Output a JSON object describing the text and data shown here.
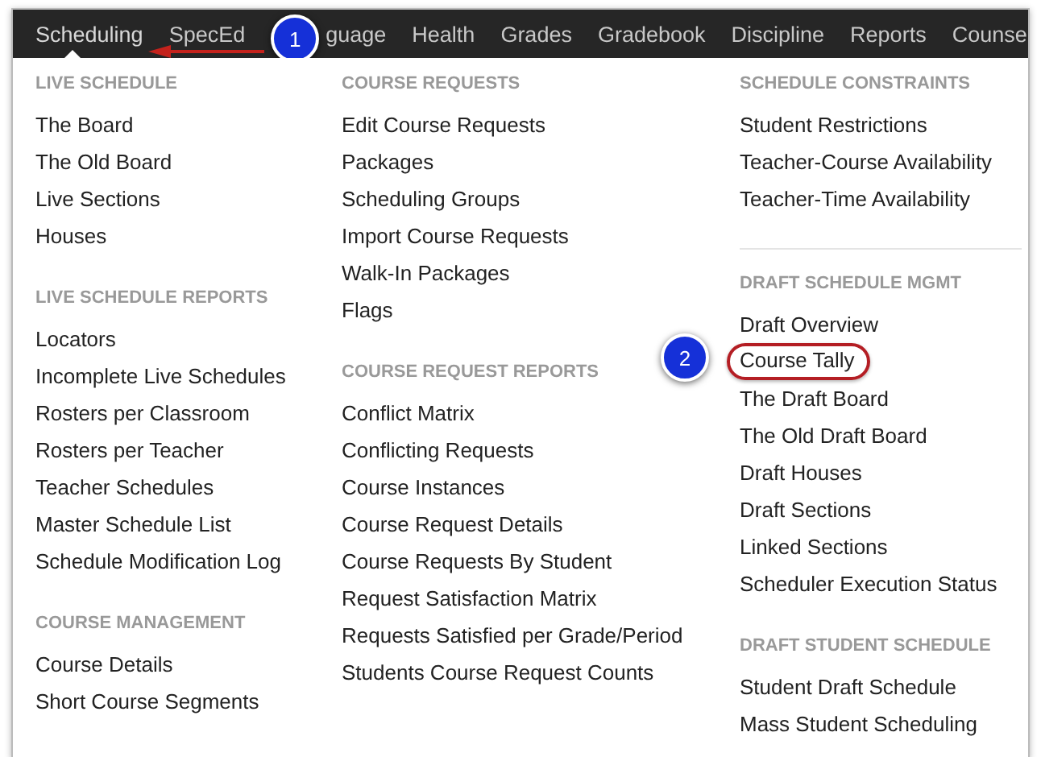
{
  "nav": [
    {
      "label": "Scheduling",
      "selected": true
    },
    {
      "label": "SpecEd",
      "selected": false
    },
    {
      "label": "guage",
      "selected": false
    },
    {
      "label": "Health",
      "selected": false
    },
    {
      "label": "Grades",
      "selected": false
    },
    {
      "label": "Gradebook",
      "selected": false
    },
    {
      "label": "Discipline",
      "selected": false
    },
    {
      "label": "Reports",
      "selected": false
    },
    {
      "label": "Counse",
      "selected": false
    }
  ],
  "columns": [
    [
      {
        "heading": "LIVE SCHEDULE",
        "items": [
          {
            "label": "The Board",
            "circled": false
          },
          {
            "label": "The Old Board",
            "circled": false
          },
          {
            "label": "Live Sections",
            "circled": false
          },
          {
            "label": "Houses",
            "circled": false
          }
        ]
      },
      {
        "heading": "LIVE SCHEDULE REPORTS",
        "items": [
          {
            "label": "Locators",
            "circled": false
          },
          {
            "label": "Incomplete Live Schedules",
            "circled": false
          },
          {
            "label": "Rosters per Classroom",
            "circled": false
          },
          {
            "label": "Rosters per Teacher",
            "circled": false
          },
          {
            "label": "Teacher Schedules",
            "circled": false
          },
          {
            "label": "Master Schedule List",
            "circled": false
          },
          {
            "label": "Schedule Modification Log",
            "circled": false
          }
        ]
      },
      {
        "heading": "COURSE MANAGEMENT",
        "items": [
          {
            "label": "Course Details",
            "circled": false
          },
          {
            "label": "Short Course Segments",
            "circled": false
          }
        ]
      }
    ],
    [
      {
        "heading": "COURSE REQUESTS",
        "items": [
          {
            "label": "Edit Course Requests",
            "circled": false
          },
          {
            "label": "Packages",
            "circled": false
          },
          {
            "label": "Scheduling Groups",
            "circled": false
          },
          {
            "label": "Import Course Requests",
            "circled": false
          },
          {
            "label": "Walk-In Packages",
            "circled": false
          },
          {
            "label": "Flags",
            "circled": false
          }
        ]
      },
      {
        "heading": "COURSE REQUEST REPORTS",
        "items": [
          {
            "label": "Conflict Matrix",
            "circled": false
          },
          {
            "label": "Conflicting Requests",
            "circled": false
          },
          {
            "label": "Course Instances",
            "circled": false
          },
          {
            "label": "Course Request Details",
            "circled": false
          },
          {
            "label": "Course Requests By Student",
            "circled": false
          },
          {
            "label": "Request Satisfaction Matrix",
            "circled": false
          },
          {
            "label": "Requests Satisfied per Grade/Period",
            "circled": false
          },
          {
            "label": "Students Course Request Counts",
            "circled": false
          }
        ]
      }
    ],
    [
      {
        "heading": "SCHEDULE CONSTRAINTS",
        "items": [
          {
            "label": "Student Restrictions",
            "circled": false
          },
          {
            "label": "Teacher-Course Availability",
            "circled": false
          },
          {
            "label": "Teacher-Time Availability",
            "circled": false
          }
        ]
      },
      {
        "heading": "DRAFT SCHEDULE MGMT",
        "items": [
          {
            "label": "Draft Overview",
            "circled": false
          },
          {
            "label": "Course Tally",
            "circled": true
          },
          {
            "label": "The Draft Board",
            "circled": false
          },
          {
            "label": "The Old Draft Board",
            "circled": false
          },
          {
            "label": "Draft Houses",
            "circled": false
          },
          {
            "label": "Draft Sections",
            "circled": false
          },
          {
            "label": "Linked Sections",
            "circled": false
          },
          {
            "label": "Scheduler Execution Status",
            "circled": false
          }
        ]
      },
      {
        "heading": "DRAFT STUDENT SCHEDULE",
        "items": [
          {
            "label": "Student Draft Schedule",
            "circled": false
          },
          {
            "label": "Mass Student Scheduling",
            "circled": false
          }
        ]
      }
    ]
  ],
  "callouts": [
    "1",
    "2"
  ]
}
